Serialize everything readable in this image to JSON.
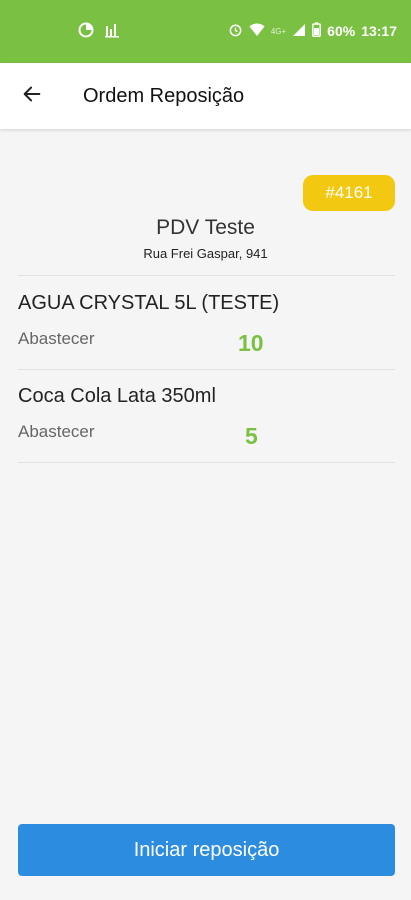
{
  "status_bar": {
    "network_label": "4G+",
    "battery": "60%",
    "time": "13:17",
    "color": "#7ac143",
    "left_icons": [
      "data-saver-icon",
      "bar-chart-icon"
    ],
    "right_icons": [
      "alarm-icon",
      "wifi-icon",
      "signal-icon",
      "battery-icon"
    ]
  },
  "app_bar": {
    "title": "Ordem Reposição",
    "back_icon": "arrow-left-icon"
  },
  "order": {
    "number": "#4161",
    "badge_color": "#f3c811"
  },
  "pdv": {
    "name": "PDV Teste",
    "address": "Rua Frei Gaspar, 941"
  },
  "items": [
    {
      "name": "AGUA CRYSTAL 5L (TESTE)",
      "action": "Abastecer",
      "quantity": "10"
    },
    {
      "name": "Coca Cola Lata 350ml",
      "action": "Abastecer",
      "quantity": "5"
    }
  ],
  "quantity_color": "#7ac143",
  "primary_button": {
    "label": "Iniciar reposição",
    "color": "#2c8de0"
  }
}
